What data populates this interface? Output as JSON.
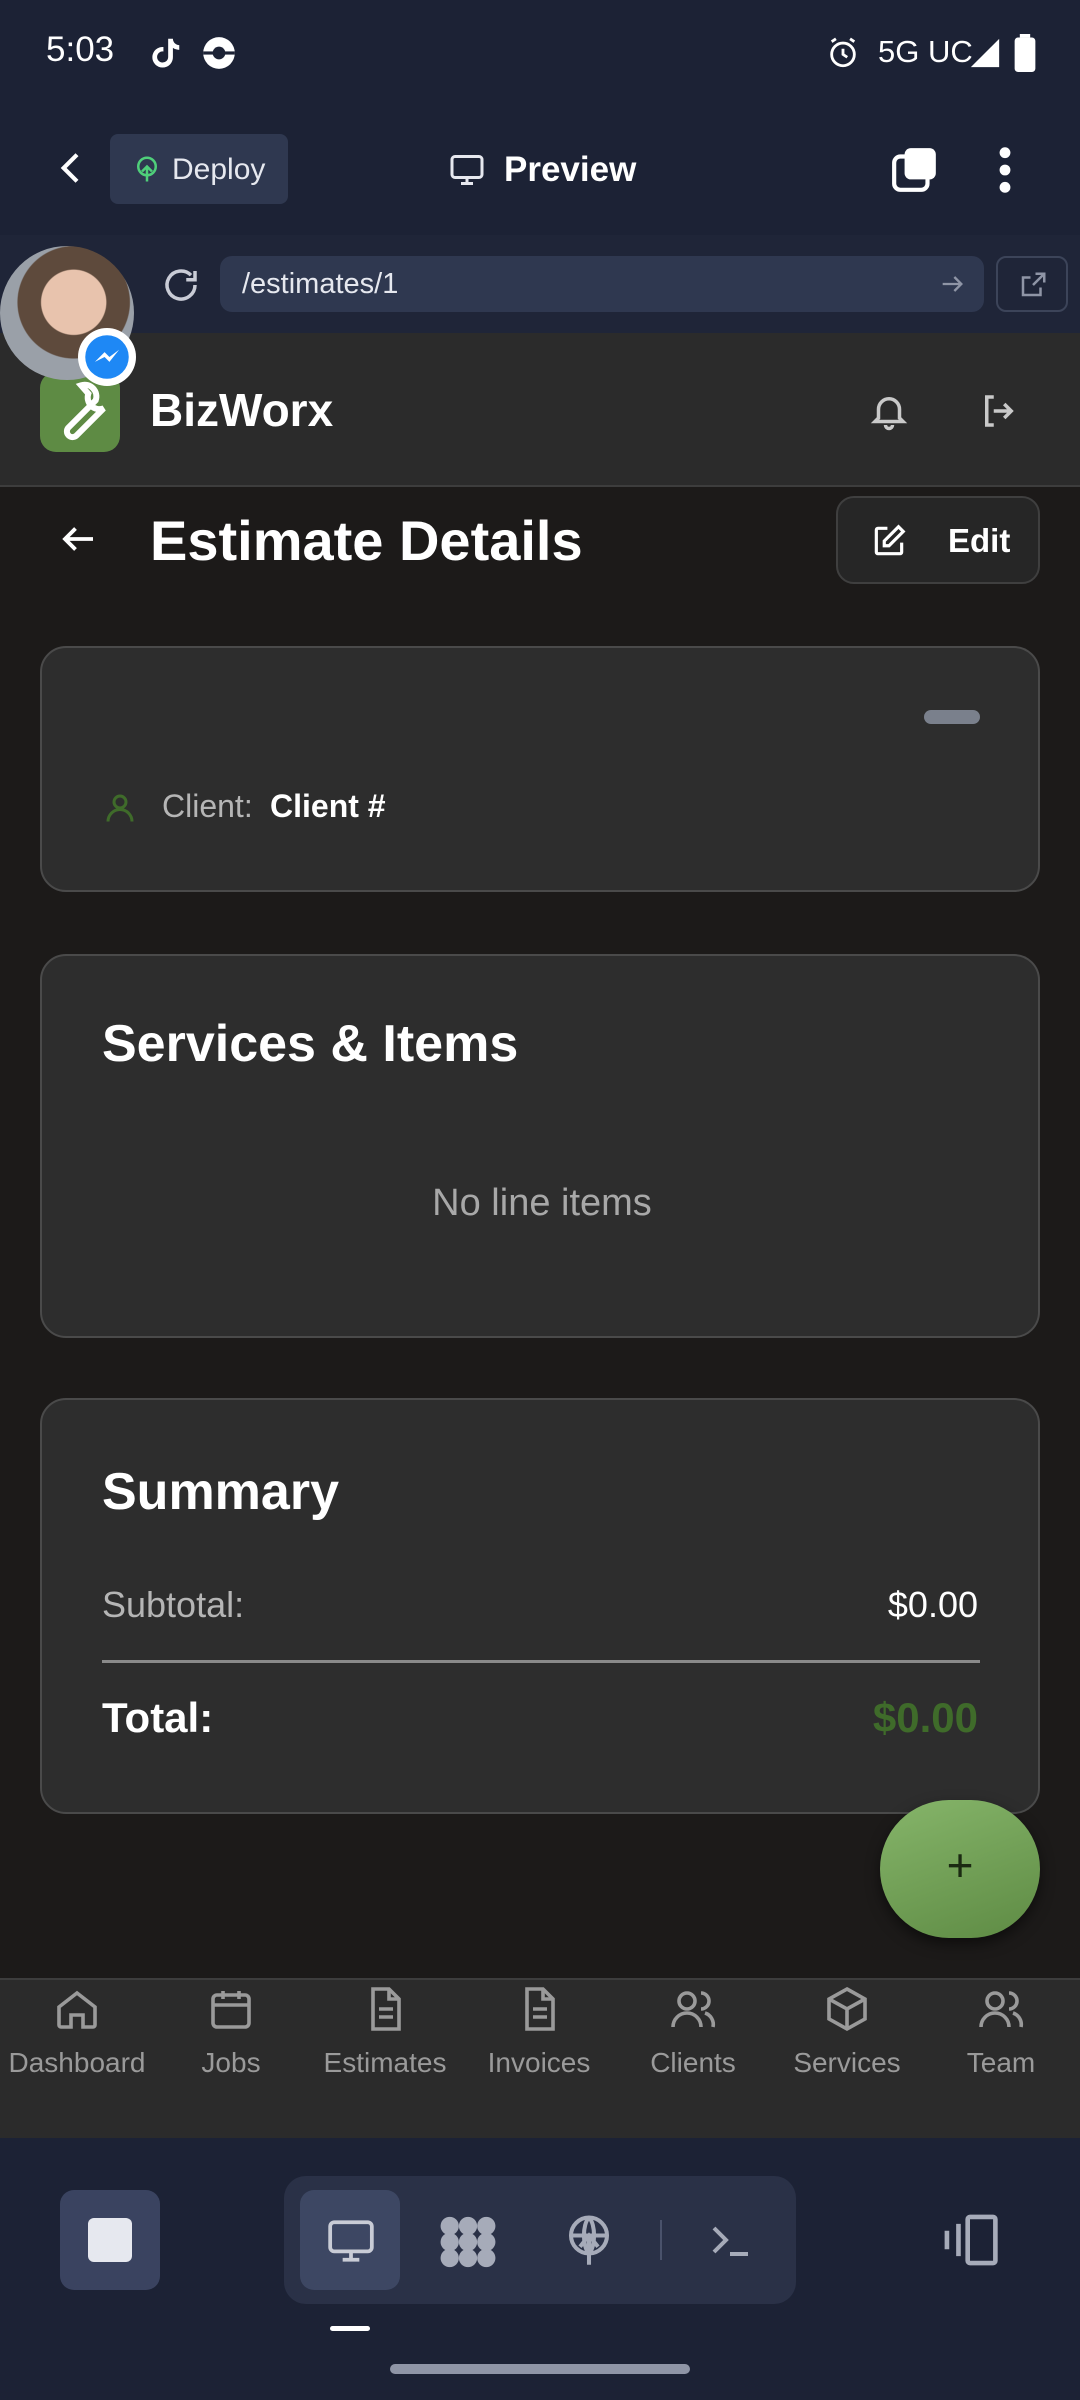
{
  "status_bar": {
    "time": "5:03",
    "network": "5G UC"
  },
  "browser": {
    "deploy_label": "Deploy",
    "preview_label": "Preview",
    "url": "/estimates/1"
  },
  "app": {
    "name": "BizWorx",
    "brand_color": "#5e8b44"
  },
  "page": {
    "title": "Estimate Details",
    "edit_label": "Edit"
  },
  "client_card": {
    "client_label": "Client:",
    "client_value": "Client #"
  },
  "services_card": {
    "title": "Services & Items",
    "empty_text": "No line items"
  },
  "summary_card": {
    "title": "Summary",
    "subtotal_label": "Subtotal:",
    "subtotal_value": "$0.00",
    "total_label": "Total:",
    "total_value": "$0.00",
    "total_color": "#3f6b2a"
  },
  "fab": {
    "label": "+"
  },
  "bottom_nav": [
    {
      "label": "Dashboard",
      "icon": "home-icon"
    },
    {
      "label": "Jobs",
      "icon": "calendar-icon"
    },
    {
      "label": "Estimates",
      "icon": "document-icon"
    },
    {
      "label": "Invoices",
      "icon": "document-icon"
    },
    {
      "label": "Clients",
      "icon": "users-icon"
    },
    {
      "label": "Services",
      "icon": "package-icon"
    },
    {
      "label": "Team",
      "icon": "users-icon"
    }
  ]
}
